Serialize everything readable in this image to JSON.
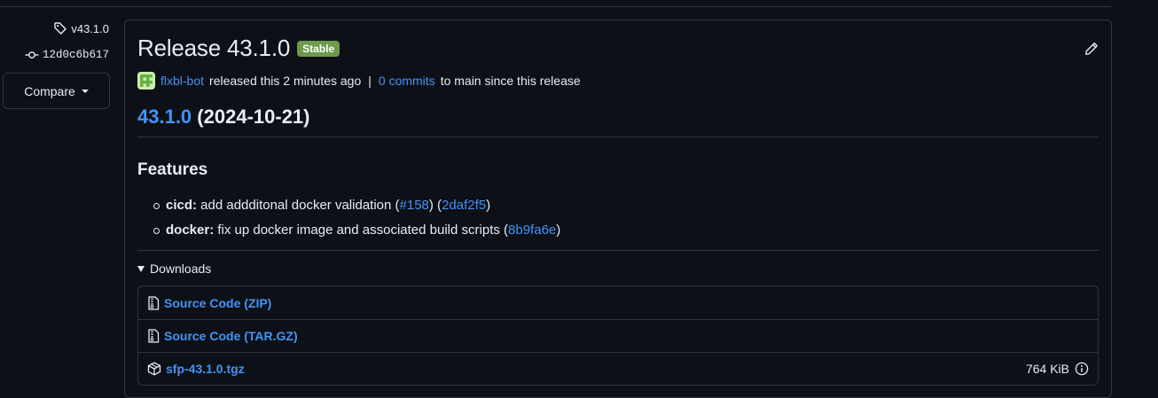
{
  "sidebar": {
    "tag_label": "v43.1.0",
    "commit_sha": "12d0c6b617",
    "compare_label": "Compare"
  },
  "release": {
    "title": "Release 43.1.0",
    "badge": "Stable",
    "author": "flxbl-bot",
    "released_text": "released this 2 minutes ago",
    "separator": "|",
    "commits_link": "0 commits",
    "commits_suffix": "to main since this release",
    "version_link": "43.1.0",
    "version_date": "(2024-10-21)"
  },
  "features": {
    "heading": "Features",
    "items": [
      {
        "scope": "cicd:",
        "text_before": " add addditonal docker validation (",
        "pr": "#158",
        "mid": ") (",
        "commit": "2daf2f5",
        "end": ")"
      },
      {
        "scope": "docker:",
        "text_before": " fix up docker image and associated build scripts (",
        "commit": "8b9fa6e",
        "end": ")"
      }
    ]
  },
  "downloads": {
    "label": "Downloads",
    "assets": [
      {
        "name": "Source Code (ZIP)",
        "icon": "file-zip-icon"
      },
      {
        "name": "Source Code (TAR.GZ)",
        "icon": "file-zip-icon"
      },
      {
        "name": "sfp-43.1.0.tgz",
        "icon": "package-icon",
        "size": "764 KiB"
      }
    ]
  },
  "colors": {
    "background": "#0d1117",
    "border": "#30363d",
    "link": "#4493f8",
    "text": "#e6edf3",
    "badge_green": "#6e9a4a"
  }
}
